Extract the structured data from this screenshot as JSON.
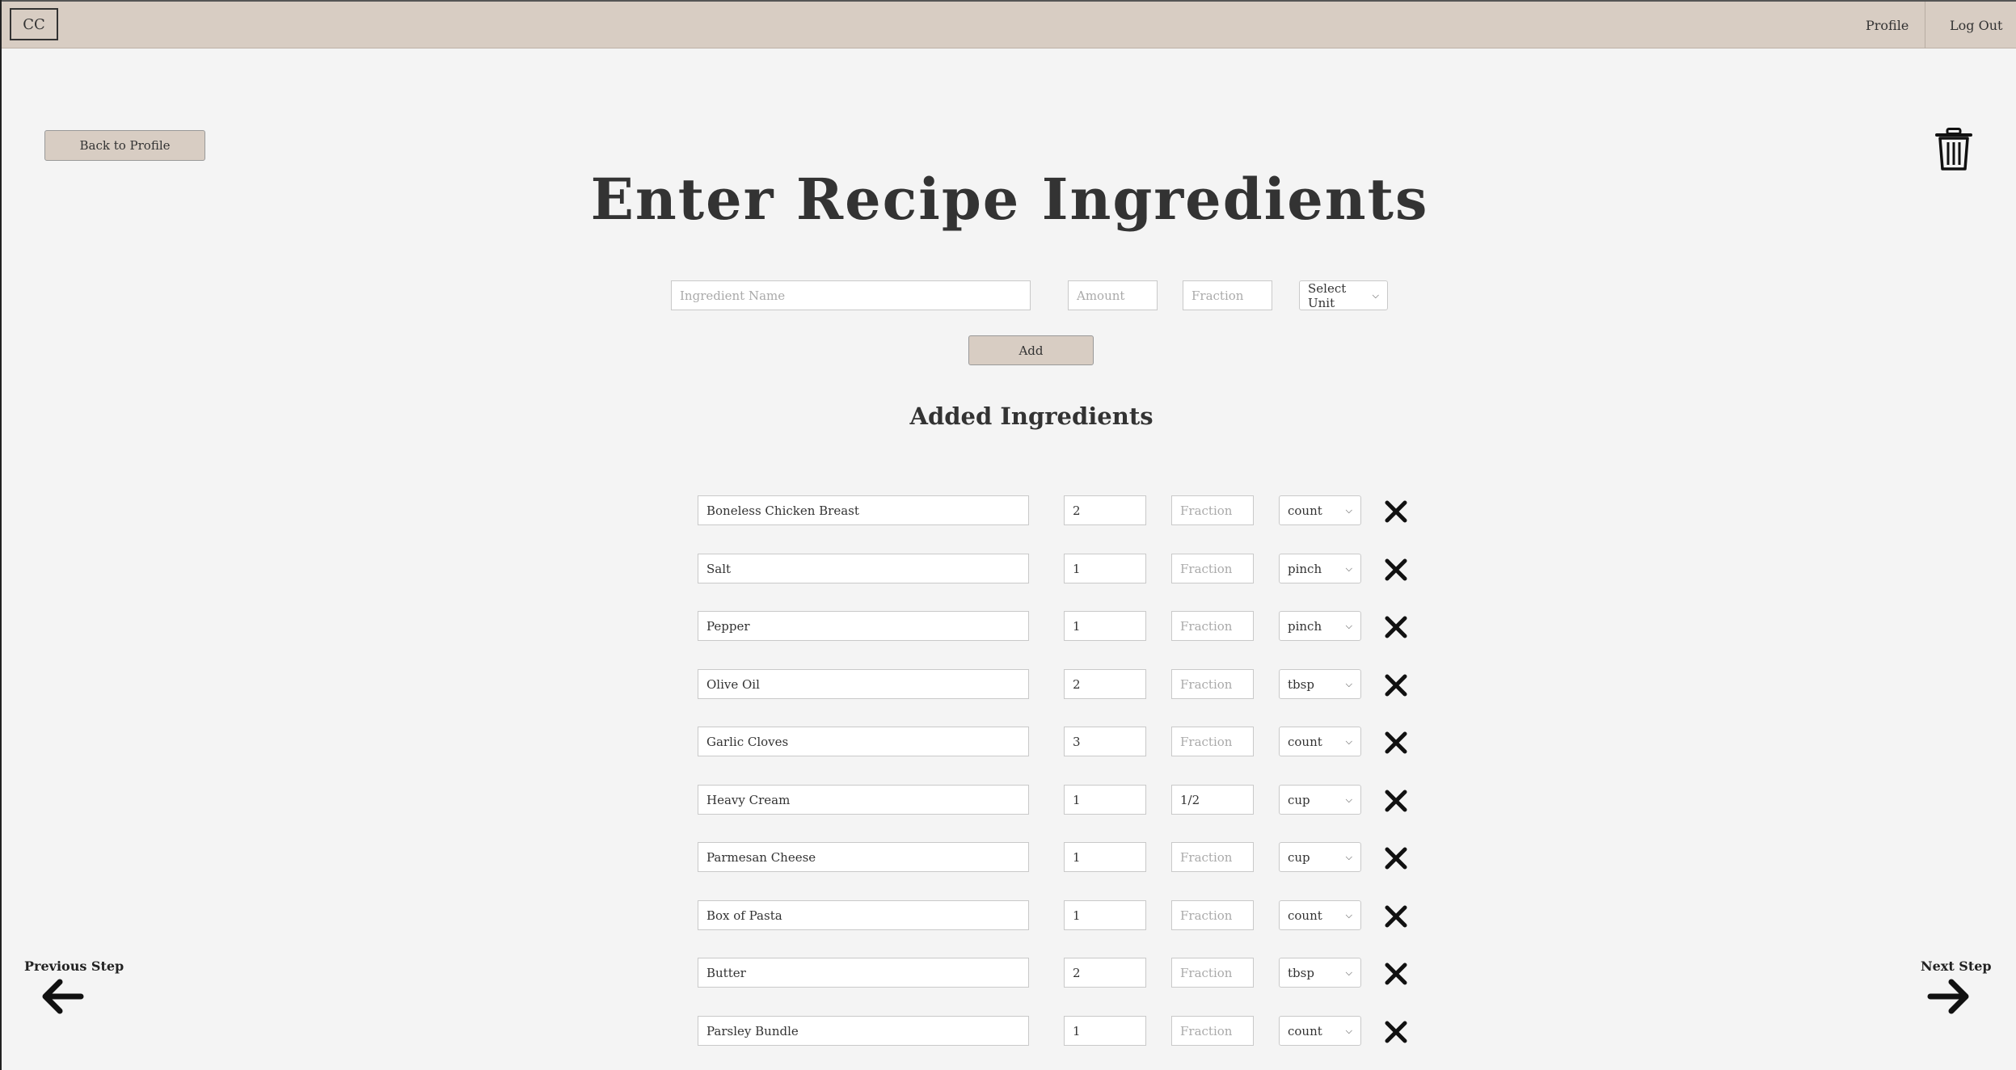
{
  "nav": {
    "logo": "CC",
    "profile": "Profile",
    "logout": "Log Out"
  },
  "back_button": "Back to Profile",
  "title": "Enter Recipe Ingredients",
  "form": {
    "name_placeholder": "Ingredient Name",
    "amount_placeholder": "Amount",
    "fraction_placeholder": "Fraction",
    "unit_selected": "Select Unit",
    "add_label": "Add"
  },
  "added_title": "Added Ingredients",
  "ingredients": [
    {
      "name": "Boneless Chicken Breast",
      "amount": "2",
      "fraction": "",
      "unit": "count"
    },
    {
      "name": "Salt",
      "amount": "1",
      "fraction": "",
      "unit": "pinch"
    },
    {
      "name": "Pepper",
      "amount": "1",
      "fraction": "",
      "unit": "pinch"
    },
    {
      "name": "Olive Oil",
      "amount": "2",
      "fraction": "",
      "unit": "tbsp"
    },
    {
      "name": "Garlic Cloves",
      "amount": "3",
      "fraction": "",
      "unit": "count"
    },
    {
      "name": "Heavy Cream",
      "amount": "1",
      "fraction": "1/2",
      "unit": "cup"
    },
    {
      "name": "Parmesan Cheese",
      "amount": "1",
      "fraction": "",
      "unit": "cup"
    },
    {
      "name": "Box of Pasta",
      "amount": "1",
      "fraction": "",
      "unit": "count"
    },
    {
      "name": "Butter",
      "amount": "2",
      "fraction": "",
      "unit": "tbsp"
    },
    {
      "name": "Parsley Bundle",
      "amount": "1",
      "fraction": "",
      "unit": "count"
    }
  ],
  "fraction_placeholder": "Fraction",
  "steps": {
    "previous": "Previous Step",
    "next": "Next Step"
  },
  "icons": {
    "trash": "trash-icon",
    "remove": "close-icon",
    "prev": "arrow-left-icon",
    "next": "arrow-right-icon"
  },
  "colors": {
    "accent": "#d8cdc3",
    "background": "#f4f4f4",
    "text": "#333333"
  }
}
